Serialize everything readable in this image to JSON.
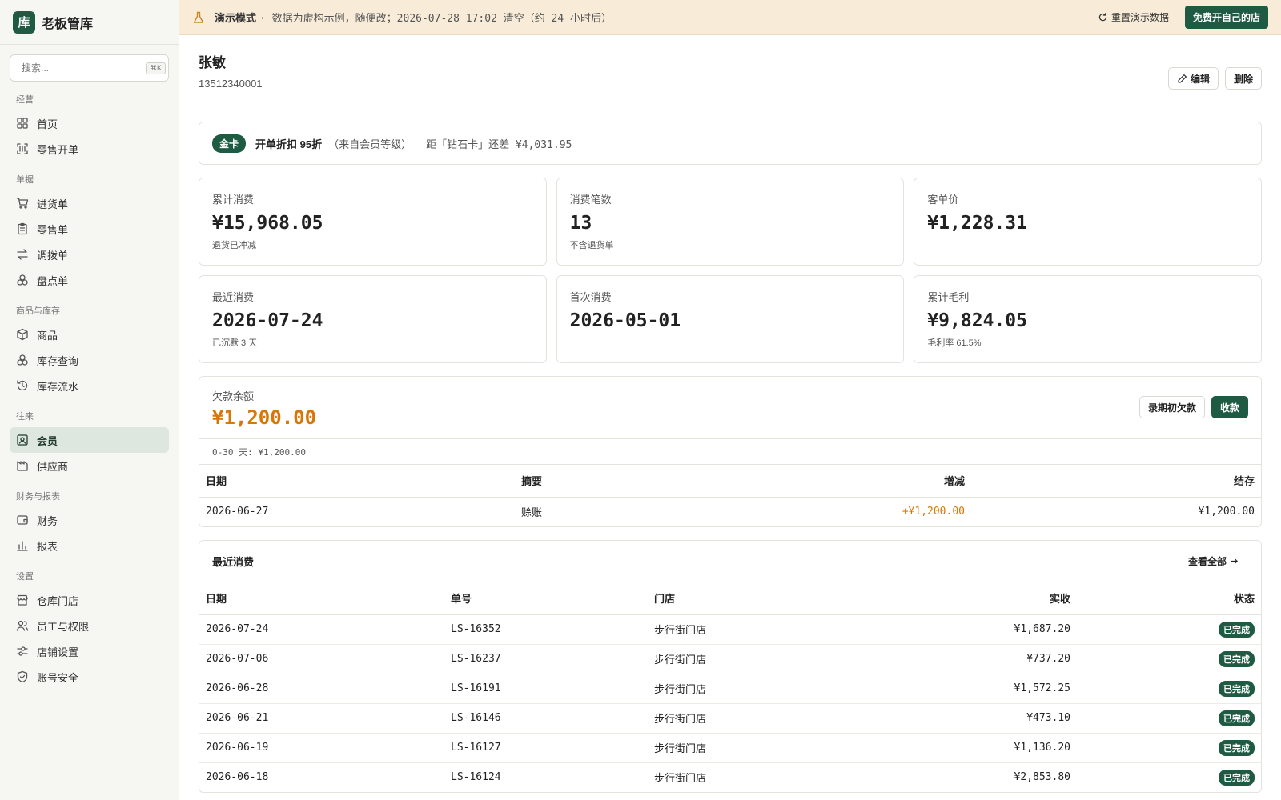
{
  "app": {
    "logo_char": "库",
    "name": "老板管库",
    "accent_color": "#1f5b43",
    "warning_color": "#d97706"
  },
  "search": {
    "placeholder": "搜索...",
    "shortcut": "⌘K"
  },
  "sidebar": {
    "sections": [
      {
        "heading": "经营",
        "items": [
          {
            "label": "首页",
            "icon": "grid-icon"
          },
          {
            "label": "零售开单",
            "icon": "scan-icon"
          }
        ]
      },
      {
        "heading": "单据",
        "items": [
          {
            "label": "进货单",
            "icon": "cart-icon"
          },
          {
            "label": "零售单",
            "icon": "clipboard-icon"
          },
          {
            "label": "调拨单",
            "icon": "transfer-icon"
          },
          {
            "label": "盘点单",
            "icon": "boxes-icon"
          }
        ]
      },
      {
        "heading": "商品与库存",
        "items": [
          {
            "label": "商品",
            "icon": "package-icon"
          },
          {
            "label": "库存查询",
            "icon": "stock-icon"
          },
          {
            "label": "库存流水",
            "icon": "history-icon"
          }
        ]
      },
      {
        "heading": "往来",
        "items": [
          {
            "label": "会员",
            "icon": "member-card-icon",
            "active": true
          },
          {
            "label": "供应商",
            "icon": "factory-icon"
          }
        ]
      },
      {
        "heading": "财务与报表",
        "items": [
          {
            "label": "财务",
            "icon": "wallet-icon"
          },
          {
            "label": "报表",
            "icon": "bar-chart-icon"
          }
        ]
      },
      {
        "heading": "设置",
        "items": [
          {
            "label": "仓库门店",
            "icon": "store-icon"
          },
          {
            "label": "员工与权限",
            "icon": "users-icon"
          },
          {
            "label": "店铺设置",
            "icon": "sliders-icon"
          },
          {
            "label": "账号安全",
            "icon": "shield-icon"
          }
        ]
      }
    ]
  },
  "banner": {
    "title": "演示模式",
    "text": "· 数据为虚构示例，随便改；2026-07-28 17:02 清空（约 24 小时后）",
    "reset_label": "重置演示数据",
    "open_shop_label": "免费开自己的店"
  },
  "member": {
    "name": "张敏",
    "phone": "13512340001",
    "edit_label": "编辑",
    "delete_label": "删除"
  },
  "tier": {
    "badge": "金卡",
    "discount": "开单折扣 95折",
    "source": "（来自会员等级）",
    "next_level": "距「钻石卡」还差 ¥4,031.95"
  },
  "stats": [
    {
      "label": "累计消费",
      "value": "¥15,968.05",
      "note": "退货已冲减"
    },
    {
      "label": "消费笔数",
      "value": "13",
      "note": "不含退货单"
    },
    {
      "label": "客单价",
      "value": "¥1,228.31",
      "note": ""
    },
    {
      "label": "最近消费",
      "value": "2026-07-24",
      "note": "已沉默 3 天"
    },
    {
      "label": "首次消费",
      "value": "2026-05-01",
      "note": ""
    },
    {
      "label": "累计毛利",
      "value": "¥9,824.05",
      "note": "毛利率 61.5%"
    }
  ],
  "debt": {
    "label": "欠款余额",
    "value": "¥1,200.00",
    "opening_debt_label": "录期初欠款",
    "collect_label": "收款",
    "aging": "0-30 天: ¥1,200.00",
    "columns": [
      "日期",
      "摘要",
      "增减",
      "结存"
    ],
    "rows": [
      {
        "date": "2026-06-27",
        "summary": "赊账",
        "change": "+¥1,200.00",
        "balance": "¥1,200.00"
      }
    ]
  },
  "recent": {
    "title": "最近消费",
    "view_all_label": "查看全部",
    "columns": [
      "日期",
      "单号",
      "门店",
      "实收",
      "状态"
    ],
    "rows": [
      {
        "date": "2026-07-24",
        "no": "LS-16352",
        "store": "步行街门店",
        "amount": "¥1,687.20",
        "status": "已完成"
      },
      {
        "date": "2026-07-06",
        "no": "LS-16237",
        "store": "步行街门店",
        "amount": "¥737.20",
        "status": "已完成"
      },
      {
        "date": "2026-06-28",
        "no": "LS-16191",
        "store": "步行街门店",
        "amount": "¥1,572.25",
        "status": "已完成"
      },
      {
        "date": "2026-06-21",
        "no": "LS-16146",
        "store": "步行街门店",
        "amount": "¥473.10",
        "status": "已完成"
      },
      {
        "date": "2026-06-19",
        "no": "LS-16127",
        "store": "步行街门店",
        "amount": "¥1,136.20",
        "status": "已完成"
      },
      {
        "date": "2026-06-18",
        "no": "LS-16124",
        "store": "步行街门店",
        "amount": "¥2,853.80",
        "status": "已完成"
      }
    ]
  }
}
